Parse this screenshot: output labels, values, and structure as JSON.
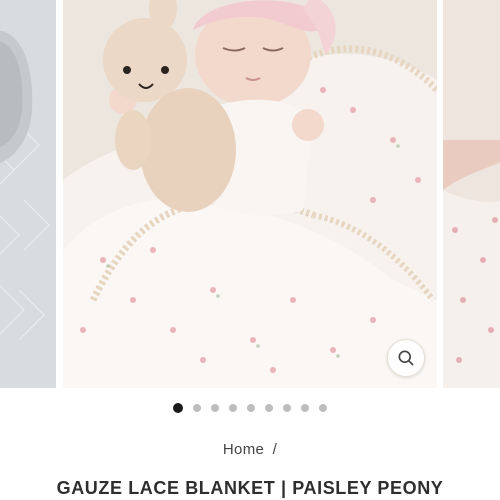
{
  "gallery": {
    "slides": [
      {
        "name": "prev-slide",
        "description_icon": "knit-blanket-photo-icon"
      },
      {
        "name": "current-slide",
        "description_icon": "newborn-blanket-photo-icon"
      },
      {
        "name": "next-slide",
        "description_icon": "floral-fabric-photo-icon"
      }
    ],
    "zoom_icon": "search-icon",
    "dots_total": 9,
    "active_index": 0
  },
  "breadcrumb": {
    "home_label": "Home",
    "separator": "/"
  },
  "product": {
    "title": "GAUZE LACE BLANKET | PAISLEY PEONY"
  },
  "colors": {
    "dot_active": "#1a1a1a",
    "dot_inactive": "#bdbdbd",
    "text": "#2e2e2e",
    "zoom_ring": "#e6dfd6"
  }
}
